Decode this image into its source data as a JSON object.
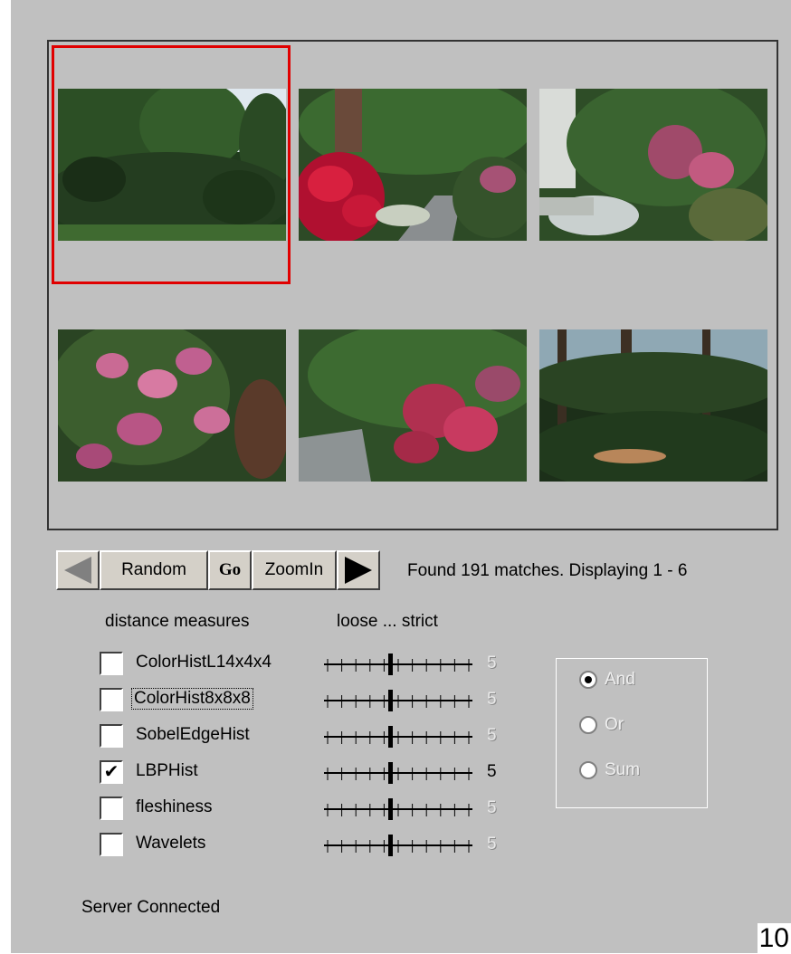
{
  "controls": {
    "random_label": "Random",
    "go_label": "Go",
    "zoom_label": "ZoomIn",
    "status_text": "Found 191 matches.  Displaying 1 - 6"
  },
  "headers": {
    "measures": "distance measures",
    "strictness": "loose ... strict"
  },
  "measures": [
    {
      "label": "ColorHistL14x4x4",
      "checked": false,
      "value": "5"
    },
    {
      "label": "ColorHist8x8x8",
      "checked": false,
      "value": "5"
    },
    {
      "label": "SobelEdgeHist",
      "checked": false,
      "value": "5"
    },
    {
      "label": "LBPHist",
      "checked": true,
      "value": "5",
      "check_mark": "✔"
    },
    {
      "label": "fleshiness",
      "checked": false,
      "value": "5"
    },
    {
      "label": "Wavelets",
      "checked": false,
      "value": "5"
    }
  ],
  "combine": {
    "options": [
      {
        "label": "And",
        "selected": true
      },
      {
        "label": "Or",
        "selected": false
      },
      {
        "label": "Sum",
        "selected": false
      }
    ]
  },
  "server_status": "Server Connected",
  "page_number": "10",
  "colors": {
    "panel_bg": "#c0c0c0",
    "selection_border": "#e00000"
  },
  "icons": {
    "prev": "left-arrow-icon",
    "next": "right-arrow-icon"
  }
}
